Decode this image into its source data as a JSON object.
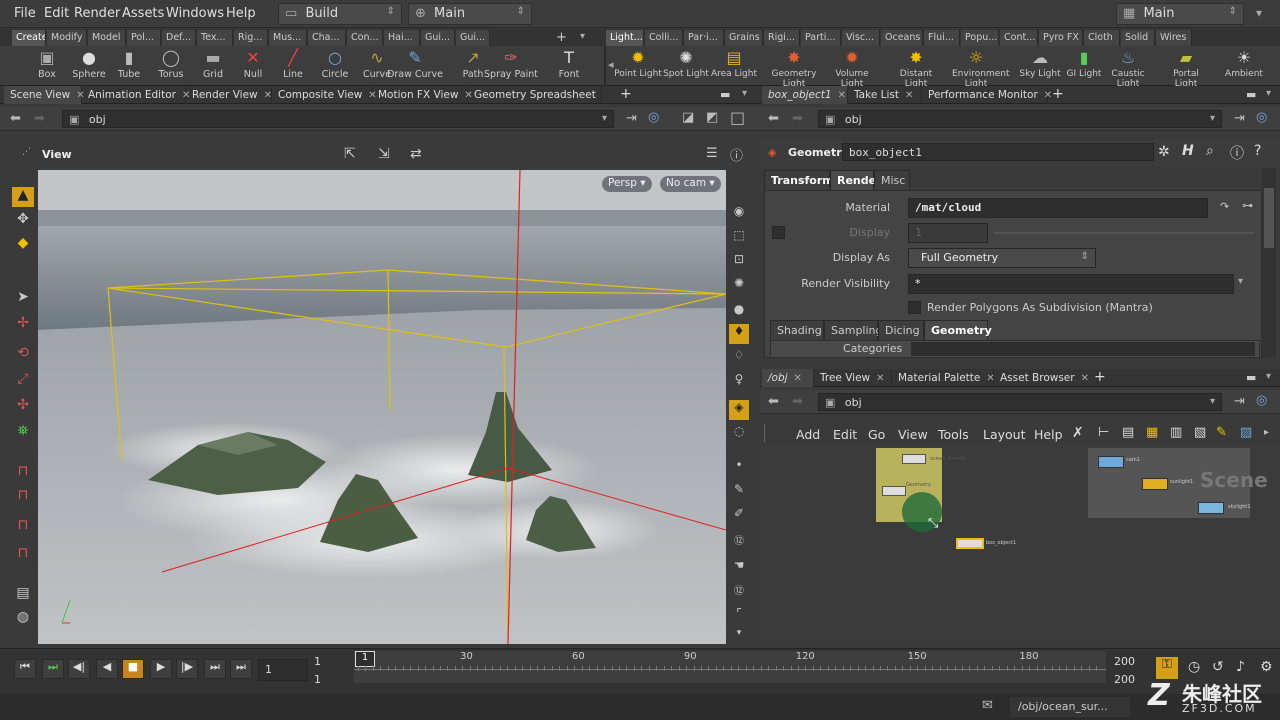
{
  "menubar": {
    "items": [
      "File",
      "Edit",
      "Render",
      "Assets",
      "Windows",
      "Help"
    ],
    "desktop": "Build",
    "context": "Main",
    "right_context": "Main"
  },
  "shelf_tabs_left": [
    "Create",
    "Modify",
    "Model",
    "Pol...",
    "Def...",
    "Tex...",
    "Rig...",
    "Mus...",
    "Cha...",
    "Con...",
    "Hai...",
    "Gui...",
    "Gui..."
  ],
  "shelf_tabs_right": [
    "Light...",
    "Colli...",
    "Par·i...",
    "Grains",
    "Rigi...",
    "Parti...",
    "Visc...",
    "Oceans",
    "Flui...",
    "Popu...",
    "Cont...",
    "Pyro FX",
    "Cloth",
    "Solid",
    "Wires"
  ],
  "tools_left": [
    "Box",
    "Sphere",
    "Tube",
    "Torus",
    "Grid",
    "Null",
    "Line",
    "Circle",
    "Curve",
    "Draw Curve",
    "Path",
    "Spray Paint",
    "Font"
  ],
  "tools_right": [
    "Point Light",
    "Spot Light",
    "Area Light",
    "Geometry Light",
    "Volume Light",
    "Distant Light",
    "Environment Light",
    "Sky Light",
    "GI Light",
    "Caustic Light",
    "Portal Light",
    "Ambient"
  ],
  "left_panel_tabs": [
    "Scene View",
    "Animation Editor",
    "Render View",
    "Composite View",
    "Motion FX View",
    "Geometry Spreadsheet"
  ],
  "left_path": "obj",
  "view_label": "View",
  "viewport": {
    "persp": "Persp",
    "cam": "No cam"
  },
  "param_tabs": [
    "box_object1",
    "Take List",
    "Performance Monitor"
  ],
  "param_path": "obj",
  "node_type": "Geometry",
  "node_name": "box_object1",
  "main_tabs": [
    "Transform",
    "Render",
    "Misc"
  ],
  "params": {
    "material_label": "Material",
    "material_value": "/mat/cloud",
    "display_label": "Display",
    "display_value": "1",
    "display_as_label": "Display As",
    "display_as_value": "Full Geometry",
    "render_vis_label": "Render Visibility",
    "render_vis_value": "*",
    "subdiv_label": "Render Polygons As Subdivision (Mantra)",
    "categories_label": "Categories"
  },
  "sub_tabs": [
    "Shading",
    "Sampling",
    "Dicing",
    "Geometry"
  ],
  "net_tabs": [
    "/obj",
    "Tree View",
    "Material Palette",
    "Asset Browser"
  ],
  "net_path": "obj",
  "net_menu": [
    "Add",
    "Edit",
    "Go",
    "View",
    "Tools",
    "Layout",
    "Help"
  ],
  "net_nodes": {
    "ocean_interior": "ocean_interior",
    "geometry": "Geometry",
    "box_object1": "box_object1",
    "cam1": "cam1",
    "sunlight1": "sunlight1",
    "skylight1": "skylight1",
    "scene": "Scene"
  },
  "timeline": {
    "current_frame": "1",
    "start": "1",
    "end": "1",
    "frame_marker": "1",
    "ticks": [
      "30",
      "60",
      "90",
      "120",
      "150",
      "180"
    ],
    "range_end_a": "200",
    "range_end_b": "200"
  },
  "status": {
    "path": "/obj/ocean_sur...",
    "watermark": "朱峰社区",
    "watermark_sub": "ZF3D.COM"
  },
  "colors": {
    "accent_yellow": "#f0c000",
    "bg": "#3a3a3a",
    "panel": "#444444"
  }
}
